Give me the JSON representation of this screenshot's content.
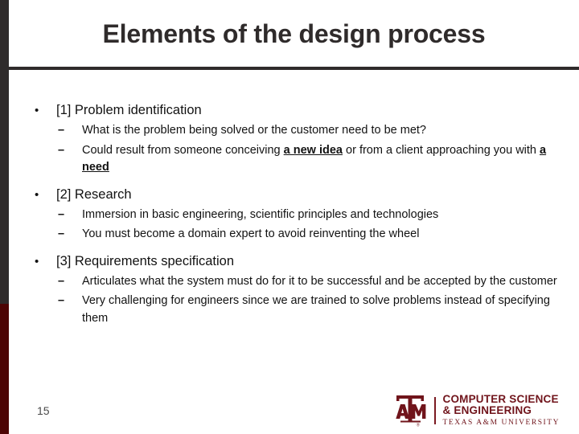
{
  "slide": {
    "title": "Elements of the design process",
    "page_number": "15",
    "accent_dark": "#2f2b2b",
    "accent_maroon": "#4d0505",
    "logo_maroon": "#70141b"
  },
  "content": {
    "bullet_marker": "•",
    "sub_marker": "–",
    "groups": [
      {
        "heading": "[1] Problem identification",
        "subs": [
          {
            "parts": [
              {
                "text": "What is the problem being solved or the customer need to be met?",
                "style": "plain"
              }
            ]
          },
          {
            "parts": [
              {
                "text": "Could result from someone conceiving ",
                "style": "plain"
              },
              {
                "text": "a new idea",
                "style": "bold-underline"
              },
              {
                "text": " or from a client approaching you with ",
                "style": "plain"
              },
              {
                "text": "a need",
                "style": "bold-underline"
              }
            ]
          }
        ]
      },
      {
        "heading": "[2] Research",
        "subs": [
          {
            "parts": [
              {
                "text": "Immersion in basic engineering, scientific principles and technologies",
                "style": "plain"
              }
            ]
          },
          {
            "parts": [
              {
                "text": "You must become a domain expert to avoid reinventing the wheel",
                "style": "plain"
              }
            ]
          }
        ]
      },
      {
        "heading": "[3] Requirements specification",
        "subs": [
          {
            "parts": [
              {
                "text": "Articulates what the system must do for it to be successful and be accepted by the customer",
                "style": "plain"
              }
            ]
          },
          {
            "parts": [
              {
                "text": "Very challenging for engineers since we are trained to solve problems instead of specifying them",
                "style": "plain"
              }
            ]
          }
        ]
      }
    ]
  },
  "logo": {
    "monogram": "A T M",
    "line1": "COMPUTER SCIENCE",
    "line2": "& ENGINEERING",
    "line3": "TEXAS A&M UNIVERSITY"
  }
}
